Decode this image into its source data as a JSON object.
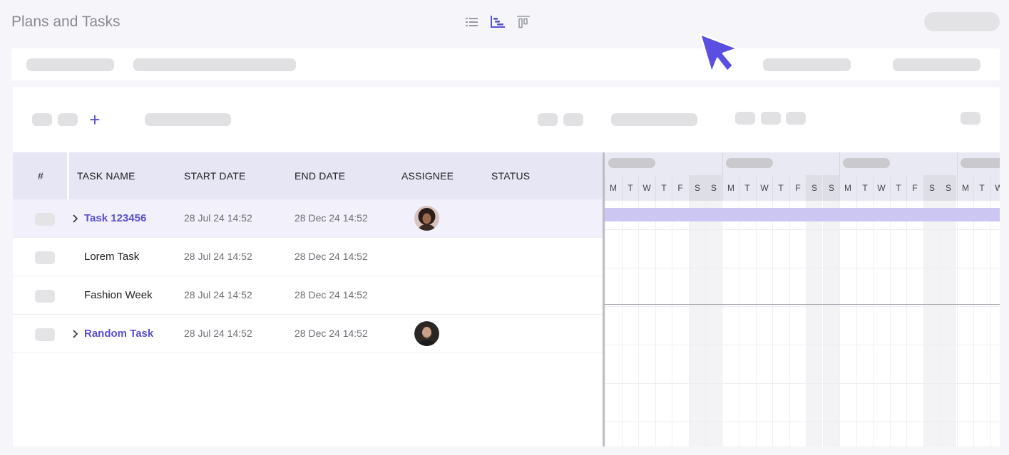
{
  "header": {
    "title": "Plans and Tasks"
  },
  "view_modes": [
    {
      "icon": "list-view-icon",
      "active": false
    },
    {
      "icon": "gantt-view-icon",
      "active": true
    },
    {
      "icon": "board-view-icon",
      "active": false
    }
  ],
  "toolbar": {
    "add_icon": "+"
  },
  "table": {
    "columns": [
      "#",
      "TASK NAME",
      "START DATE",
      "END DATE",
      "ASSIGNEE",
      "STATUS"
    ],
    "rows": [
      {
        "name": "Task 123456",
        "start": "28 Jul 24 14:52",
        "end": "28 Dec 24 14:52",
        "expandable": true,
        "selected": true,
        "has_assignee": true
      },
      {
        "name": "Lorem Task",
        "start": "28 Jul 24 14:52",
        "end": "28 Dec 24 14:52",
        "expandable": false,
        "selected": false,
        "has_assignee": false
      },
      {
        "name": "Fashion Week",
        "start": "28 Jul 24 14:52",
        "end": "28 Dec 24 14:52",
        "expandable": false,
        "selected": false,
        "has_assignee": false
      },
      {
        "name": "Random Task",
        "start": "28 Jul 24 14:52",
        "end": "28 Dec 24 14:52",
        "expandable": true,
        "selected": false,
        "has_assignee": true
      }
    ]
  },
  "gantt": {
    "days": [
      "M",
      "T",
      "W",
      "T",
      "F",
      "S",
      "S",
      "M",
      "T",
      "W",
      "T",
      "F",
      "S",
      "S",
      "M",
      "T",
      "W",
      "T",
      "F",
      "S",
      "S",
      "M",
      "T",
      "W"
    ]
  },
  "colors": {
    "accent": "#5a4fd2",
    "gantt_bar": "#ccc7f2",
    "header_bg": "#e7e6f4"
  }
}
